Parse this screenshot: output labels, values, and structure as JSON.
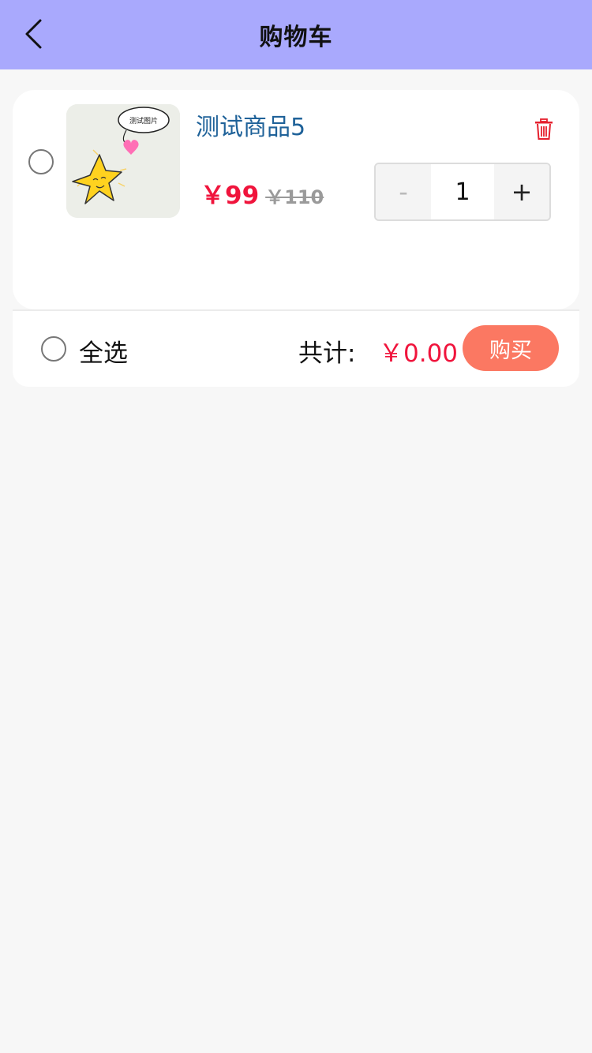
{
  "header": {
    "title": "购物车"
  },
  "cart": {
    "items": [
      {
        "image_label": "测试图片",
        "name": "测试商品5",
        "price": "￥99",
        "original_price": "￥110",
        "quantity": "1",
        "minus_label": "-",
        "plus_label": "+"
      }
    ]
  },
  "footer": {
    "select_all_label": "全选",
    "total_label": "共计:",
    "total_value": "￥0.00",
    "buy_label": "购买"
  },
  "colors": {
    "header_bg": "#a9a9fd",
    "price_red": "#f0143c",
    "name_blue": "#1f6299",
    "buy_button": "#fb7862"
  }
}
